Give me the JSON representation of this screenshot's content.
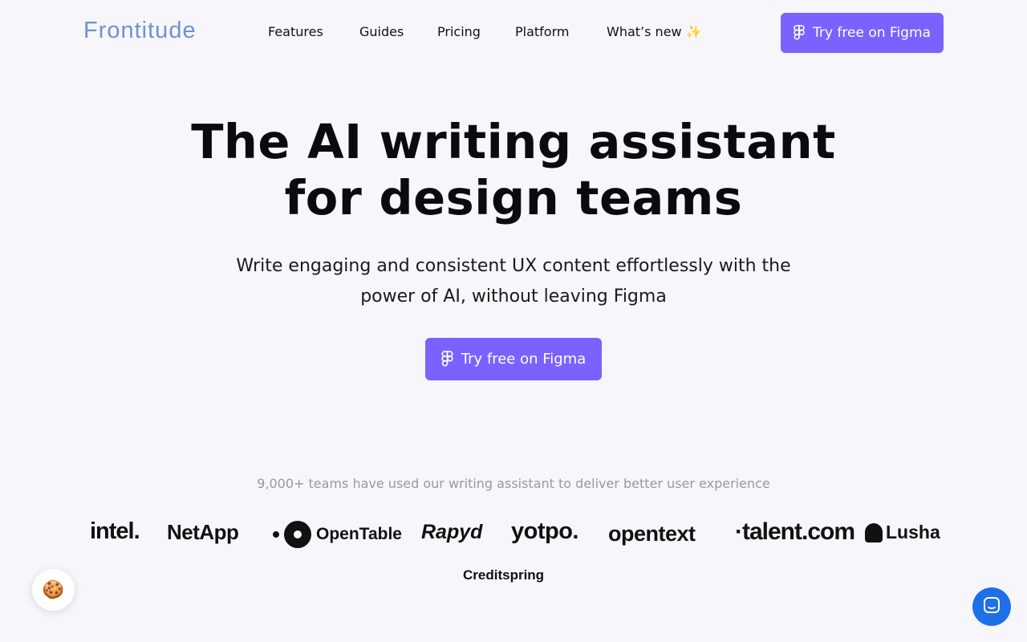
{
  "header": {
    "logo": "Frontitude",
    "nav": [
      {
        "label": "Features"
      },
      {
        "label": "Guides"
      },
      {
        "label": "Pricing"
      },
      {
        "label": "Platform"
      },
      {
        "label": "What’s new",
        "emoji": "✨"
      }
    ],
    "cta_label": "Try free on Figma"
  },
  "hero": {
    "headline_line1": "The AI writing assistant",
    "headline_line2": "for design teams",
    "sub_line1": "Write engaging and consistent UX content effortlessly with the",
    "sub_line2": "power of AI, without leaving Figma",
    "cta_label": "Try free on Figma"
  },
  "social_proof": {
    "tagline": "9,000+ teams have used our writing assistant to deliver better user experience",
    "logos": {
      "intel": "intel.",
      "netapp": "NetApp",
      "opentable": "OpenTable",
      "rapyd": "Rapyd",
      "yotpo": "yotpo.",
      "opentext": "opentext",
      "talent": "·talent.com",
      "lusha": "Lusha",
      "creditspring": "Creditspring"
    }
  },
  "floating": {
    "cookie_icon": "🍪"
  },
  "colors": {
    "accent": "#7b61ff",
    "logo": "#6e93d0",
    "chat": "#1f6fe8",
    "background": "#f7f6fb"
  }
}
